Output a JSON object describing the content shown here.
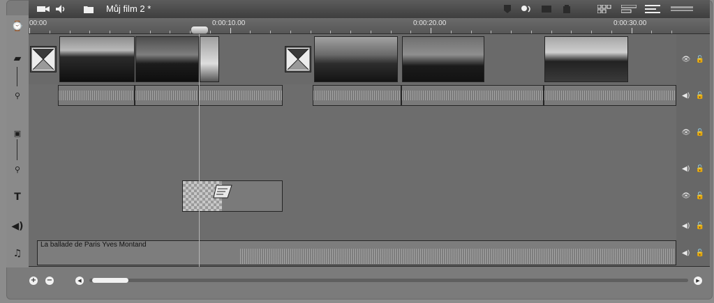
{
  "window": {
    "title": "Můj film 2 *"
  },
  "toolbar": {
    "left_icons": [
      "camcorder-icon",
      "speaker-icon",
      "folder-icon"
    ],
    "right_icons": [
      "marker-icon",
      "voiceover-icon",
      "snapshot-icon",
      "trash-icon"
    ],
    "view_icons": [
      "storyboard-view-icon",
      "timeline-view-icon",
      "text-view-icon",
      "zoom-slider-icon"
    ]
  },
  "ruler": {
    "labels": [
      "00:00",
      "0:00:10.00",
      "0:00:20.00",
      "0:00:30.00"
    ]
  },
  "left_icons": [
    "clock-icon",
    "video-track-icon",
    "audio-link-icon",
    "overlay-track-icon",
    "overlay-audio-icon",
    "title-track-icon",
    "sound-track-icon",
    "music-track-icon"
  ],
  "tracks": {
    "music_clip_label": "La ballade de Paris Yves Montand"
  },
  "bottom": {
    "zoom_in": "+",
    "zoom_out": "−",
    "scroll_left": "◀",
    "scroll_right": "▶"
  },
  "colors": {
    "bg": "#8c8c8c",
    "track": "#6d6d6d",
    "topbar": "#3e3e3e",
    "accent": "#ffffff"
  }
}
